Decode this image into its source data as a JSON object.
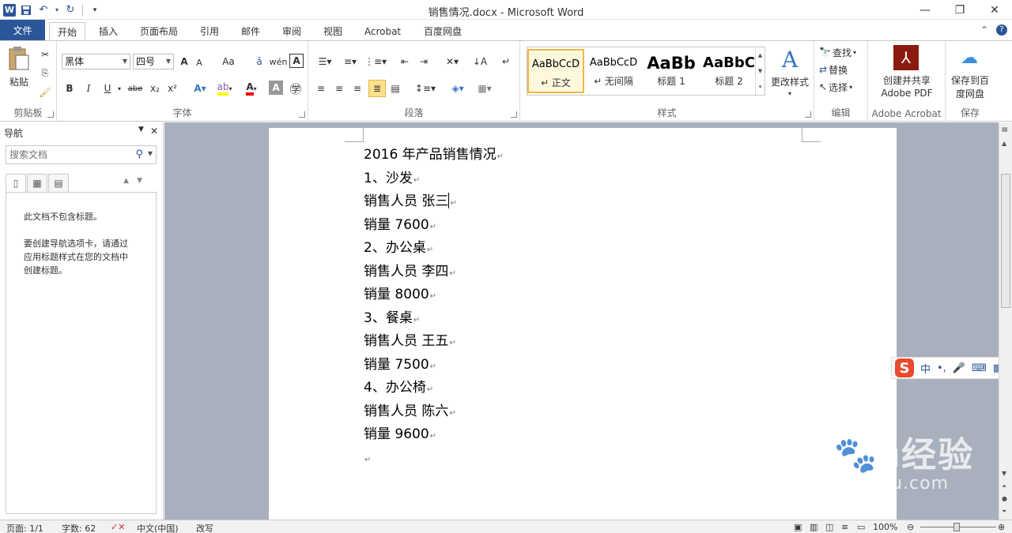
{
  "window": {
    "title": "销售情况.docx  -  Microsoft Word",
    "app_icon_letter": "W",
    "controls": {
      "minimize": "—",
      "maximize": "❐",
      "close": "✕"
    }
  },
  "tabs": [
    "文件",
    "开始",
    "插入",
    "页面布局",
    "引用",
    "邮件",
    "审阅",
    "视图",
    "Acrobat",
    "百度网盘"
  ],
  "ribbon": {
    "clipboard": {
      "label": "剪贴板",
      "paste": "粘贴"
    },
    "font": {
      "label": "字体",
      "font_name": "黑体",
      "font_size": "四号",
      "grow": "A",
      "shrink": "A",
      "change_case": "Aa",
      "bold": "B",
      "italic": "I",
      "underline": "U",
      "strike": "abe",
      "subscript": "x₂",
      "superscript": "x²"
    },
    "paragraph": {
      "label": "段落"
    },
    "styles": {
      "label": "样式",
      "items": [
        {
          "sample": "AaBbCcD",
          "name": "↵ 正文"
        },
        {
          "sample": "AaBbCcD",
          "name": "↵ 无间隔"
        },
        {
          "sample": "AaBb",
          "name": "标题 1"
        },
        {
          "sample": "AaBbC",
          "name": "标题 2"
        }
      ],
      "change_styles": "更改样式"
    },
    "editing": {
      "label": "编辑",
      "find": "查找",
      "replace": "替换",
      "select": "选择"
    },
    "acrobat": {
      "label": "Adobe Acrobat",
      "create_pdf_line1": "创建并共享",
      "create_pdf_line2": "Adobe PDF"
    },
    "save": {
      "label": "保存",
      "save_line1": "保存到百",
      "save_line2": "度网盘"
    }
  },
  "nav": {
    "title": "导航",
    "search_placeholder": "搜索文档",
    "empty_line1": "此文档不包含标题。",
    "empty_line2": "要创建导航选项卡，请通过",
    "empty_line3": "应用标题样式在您的文档中",
    "empty_line4": "创建标题。"
  },
  "document": {
    "lines": [
      "2016 年产品销售情况",
      "1、沙发",
      "销售人员 张三",
      "销量 7600",
      "2、办公桌",
      "销售人员 李四",
      "销量 8000",
      "3、餐桌",
      "销售人员 王五",
      "销量 7500",
      "4、办公椅",
      "销售人员 陈六",
      "销量 9600",
      ""
    ],
    "cursor_line": 2
  },
  "ime": {
    "logo": "S",
    "mode": "中",
    "punct": "•,",
    "mic": "🎤",
    "keyboard": "⌨",
    "apps": "▦"
  },
  "watermark": {
    "brand": "Bai🐾u经验",
    "sub": "jingyan.baidu.com"
  },
  "status": {
    "page": "页面: 1/1",
    "words": "字数: 62",
    "language": "中文(中国)",
    "mode": "改写",
    "zoom": "100%"
  }
}
